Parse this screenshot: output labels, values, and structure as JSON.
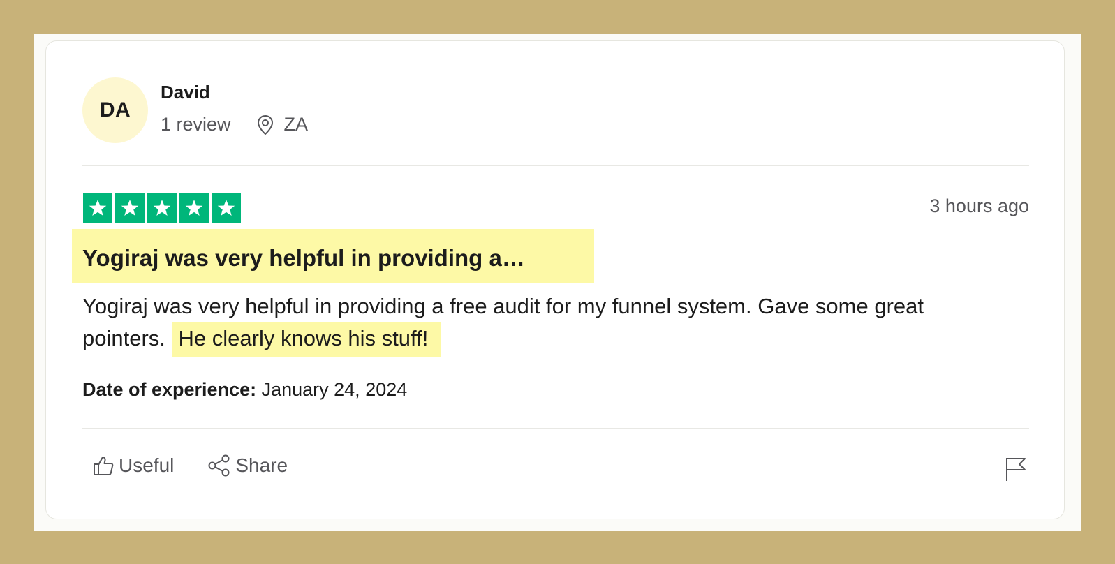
{
  "colors": {
    "frame": "#c8b279",
    "star_green": "#00b67a",
    "highlight": "#fdf9a6",
    "avatar_bg": "#fdf7d0"
  },
  "reviewer": {
    "initials": "DA",
    "name": "David",
    "review_count": "1 review",
    "location_icon": "location-pin-icon",
    "country": "ZA"
  },
  "review": {
    "rating": 5,
    "rating_max": 5,
    "timestamp": "3 hours ago",
    "title": "Yogiraj was very helpful in providing a…",
    "body_main": "Yogiraj was very helpful in providing a free audit for my funnel system. Gave some great pointers. ",
    "body_highlight": "He clearly knows his stuff!",
    "date_label": "Date of experience:",
    "date_value": " January 24, 2024"
  },
  "actions": {
    "useful_icon": "thumbs-up-icon",
    "useful_label": "Useful",
    "share_icon": "share-icon",
    "share_label": "Share",
    "flag_icon": "flag-icon"
  }
}
